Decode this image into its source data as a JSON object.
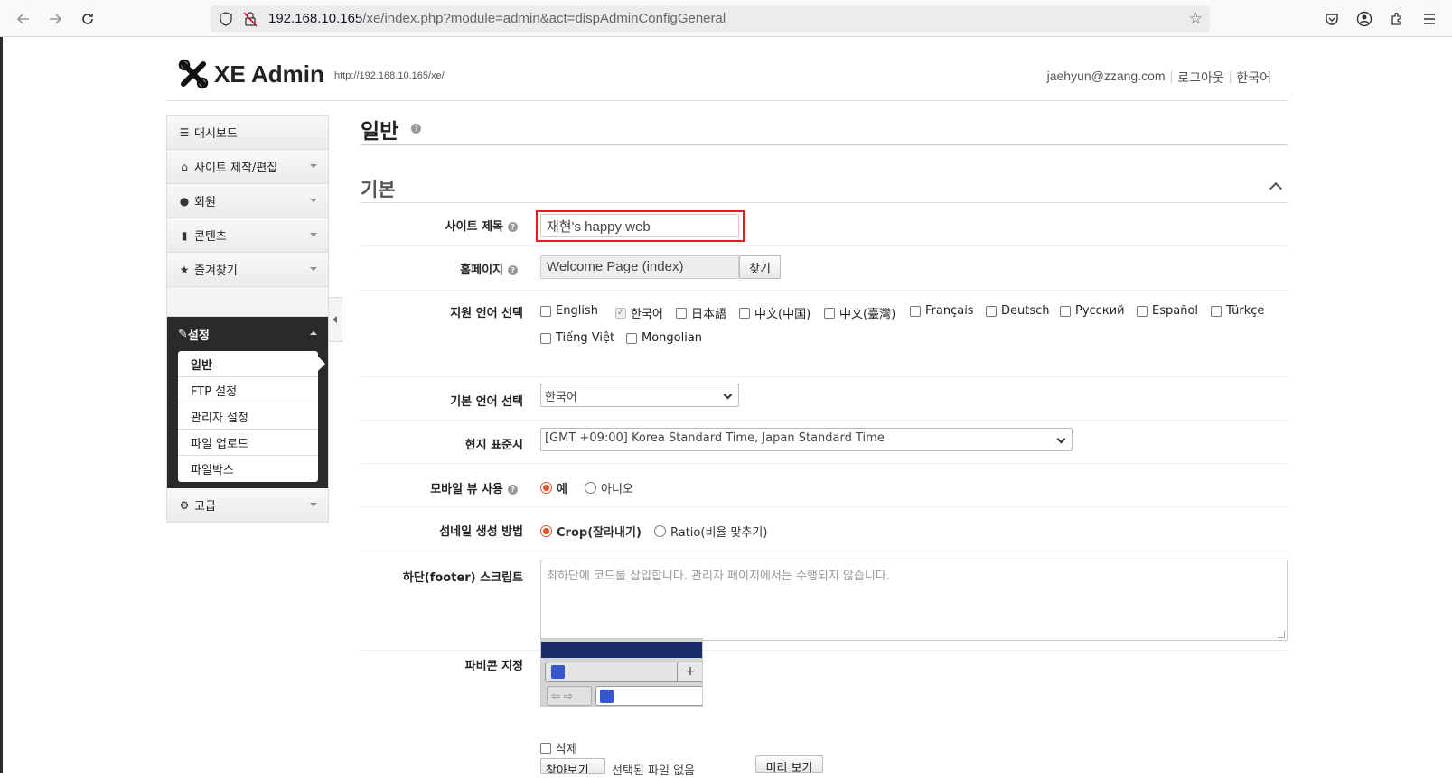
{
  "browser": {
    "url_host": "192.168.10.165",
    "url_path": "/xe/index.php?module=admin&act=dispAdminConfigGeneral"
  },
  "header": {
    "logo_text": "XE Admin",
    "site_url": "http://192.168.10.165/xe/",
    "user_email": "jaehyun@zzang.com",
    "logout": "로그아웃",
    "language": "한국어"
  },
  "sidebar": {
    "items": [
      {
        "label": "대시보드",
        "icon": "dashboard-icon"
      },
      {
        "label": "사이트 제작/편집",
        "icon": "home-icon"
      },
      {
        "label": "회원",
        "icon": "user-icon"
      },
      {
        "label": "콘텐츠",
        "icon": "book-icon"
      },
      {
        "label": "즐겨찾기",
        "icon": "star-icon"
      }
    ],
    "active_section": "설정",
    "sub_items": [
      "일반",
      "FTP 설정",
      "관리자 설정",
      "파일 업로드",
      "파일박스"
    ],
    "advanced": "고급"
  },
  "main": {
    "title": "일반",
    "section": "기본",
    "site_title_label": "사이트 제목",
    "site_title_value": "재현's happy web",
    "homepage_label": "홈페이지",
    "homepage_value": "Welcome Page (index)",
    "find_button": "찾기",
    "lang_label": "지원 언어 선택",
    "languages": [
      "English",
      "한국어",
      "日本語",
      "中文(中国)",
      "中文(臺灣)",
      "Français",
      "Deutsch",
      "Русский",
      "Español",
      "Türkçe",
      "Tiếng Việt",
      "Mongolian"
    ],
    "default_lang_label": "기본 언어 선택",
    "default_lang_value": "한국어",
    "timezone_label": "현지 표준시",
    "timezone_value": "[GMT +09:00] Korea Standard Time, Japan Standard Time",
    "mobile_label": "모바일 뷰 사용",
    "mobile_yes": "예",
    "mobile_no": "아니오",
    "thumb_label": "섬네일 생성 방법",
    "thumb_crop": "Crop(잘라내기)",
    "thumb_ratio": "Ratio(비율 맞추기)",
    "footer_label": "하단(footer) 스크립트",
    "footer_placeholder": "최하단에 코드를 삽입합니다. 관리자 페이지에서는 수행되지 않습니다.",
    "favicon_label": "파비콘 지정",
    "delete_label": "삭제",
    "browse_button": "찾아보기...",
    "no_file": "선택된 파일 없음",
    "preview_button": "미리 보기"
  },
  "colors": {
    "accent": "#e0542c",
    "highlight": "#e02020",
    "sidebar_active": "#2a2a2a"
  }
}
